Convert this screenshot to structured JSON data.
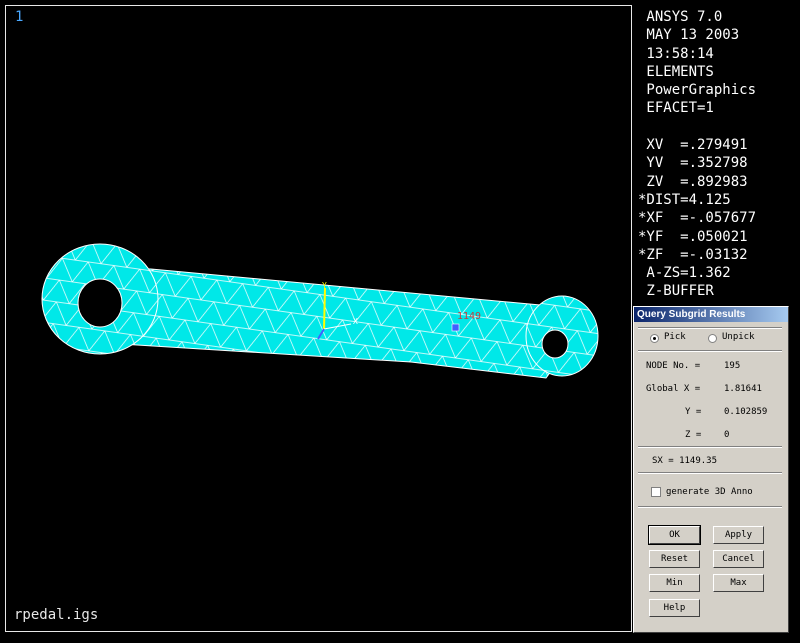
{
  "viewport": {
    "window_number": "1",
    "file_name": "rpedal.igs",
    "background": "#000000",
    "mesh_color": "#00e8e8",
    "edge_color": "#ffffff",
    "node_label": "1149",
    "triad_labels": {
      "y": "Y",
      "x": "X",
      "z": "Z"
    }
  },
  "info_panel": {
    "lines": [
      " ANSYS 7.0",
      " MAY 13 2003",
      " 13:58:14",
      " ELEMENTS",
      " PowerGraphics",
      " EFACET=1",
      "",
      " XV  =.279491",
      " YV  =.352798",
      " ZV  =.892983",
      "*DIST=4.125",
      "*XF  =-.057677",
      "*YF  =.050021",
      "*ZF  =-.03132",
      " A-ZS=1.362",
      " Z-BUFFER"
    ]
  },
  "dialog": {
    "title": "Query Subgrid Results",
    "pick_label": "Pick",
    "unpick_label": "Unpick",
    "node_label": "NODE No. =",
    "node_value": "195",
    "global_x_label": "Global X =",
    "global_x_value": "1.81641",
    "y_label": "Y =",
    "y_value": "0.102859",
    "z_label": "Z =",
    "z_value": "0",
    "sx_text": "SX = 1149.35",
    "generate_label": "generate 3D Anno",
    "buttons": {
      "ok": "OK",
      "apply": "Apply",
      "reset": "Reset",
      "cancel": "Cancel",
      "min": "Min",
      "max": "Max",
      "help": "Help"
    }
  }
}
